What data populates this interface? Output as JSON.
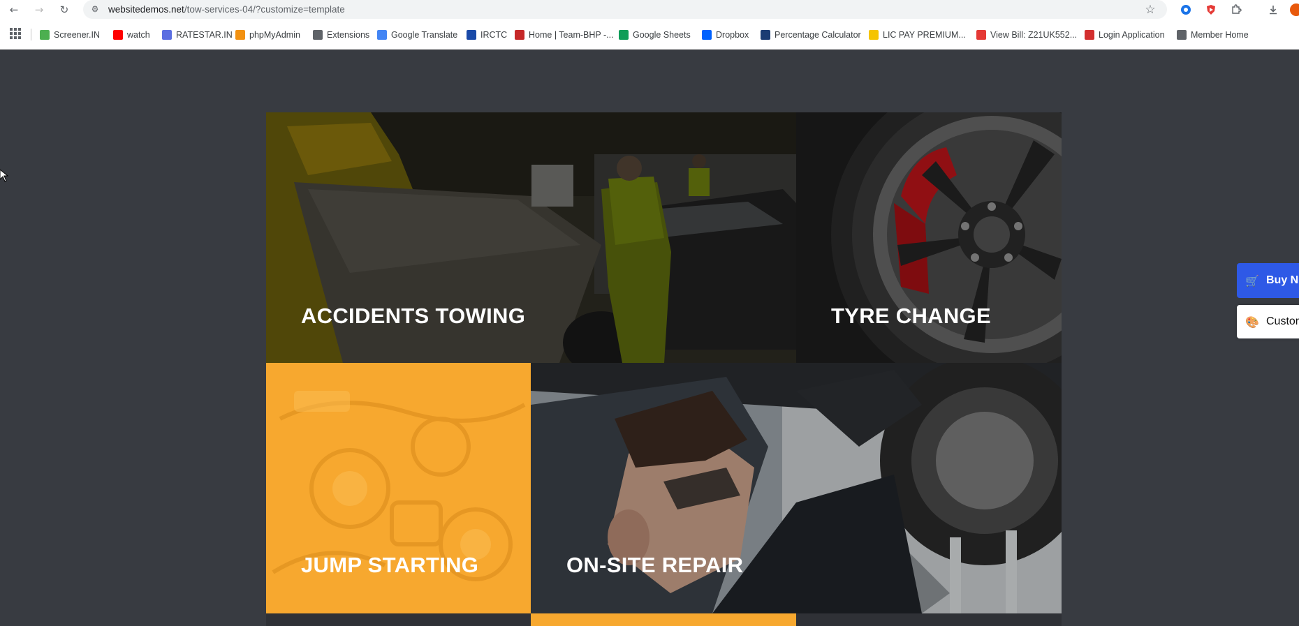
{
  "browser": {
    "nav": {
      "back_icon": "arrow-left-icon",
      "forward_icon": "arrow-right-icon",
      "reload_icon": "reload-icon"
    },
    "url": {
      "host": "websitedemos.net",
      "path": "/tow-services-04/?customize=template"
    },
    "bookmarks": [
      {
        "label": "Screener.IN",
        "icon": "bar-chart-icon",
        "color": "#4caf50"
      },
      {
        "label": "watch",
        "icon": "youtube-icon",
        "color": "#ff0000"
      },
      {
        "label": "RATESTAR.IN",
        "icon": "ratestar-icon",
        "color": "#5b6ee1"
      },
      {
        "label": "phpMyAdmin",
        "icon": "phpmyadmin-icon",
        "color": "#f29111"
      },
      {
        "label": "Extensions",
        "icon": "puzzle-icon",
        "color": "#5f6368"
      },
      {
        "label": "Google Translate",
        "icon": "translate-icon",
        "color": "#4285f4"
      },
      {
        "label": "IRCTC",
        "icon": "irctc-icon",
        "color": "#1a4aa8"
      },
      {
        "label": "Home | Team-BHP -...",
        "icon": "teambhp-icon",
        "color": "#c62828"
      },
      {
        "label": "Google Sheets",
        "icon": "sheets-icon",
        "color": "#0f9d58"
      },
      {
        "label": "Dropbox",
        "icon": "dropbox-icon",
        "color": "#0061fe"
      },
      {
        "label": "Percentage Calculator",
        "icon": "percent-icon",
        "color": "#1b3c73"
      },
      {
        "label": "LIC PAY PREMIUM...",
        "icon": "lic-icon",
        "color": "#f5c400"
      },
      {
        "label": "View Bill: Z21UK552...",
        "icon": "bill-icon",
        "color": "#e53935"
      },
      {
        "label": "Login Application",
        "icon": "login-icon",
        "color": "#d32f2f"
      },
      {
        "label": "Member Home",
        "icon": "globe-icon",
        "color": "#5f6368"
      }
    ]
  },
  "tiles": [
    {
      "title": "ACCIDENTS TOWING"
    },
    {
      "title": "TYRE CHANGE"
    },
    {
      "title": "JUMP STARTING"
    },
    {
      "title": "ON-SITE REPAIR"
    }
  ],
  "side_buttons": {
    "buy_label": "Buy N",
    "customize_label": "Custor"
  }
}
